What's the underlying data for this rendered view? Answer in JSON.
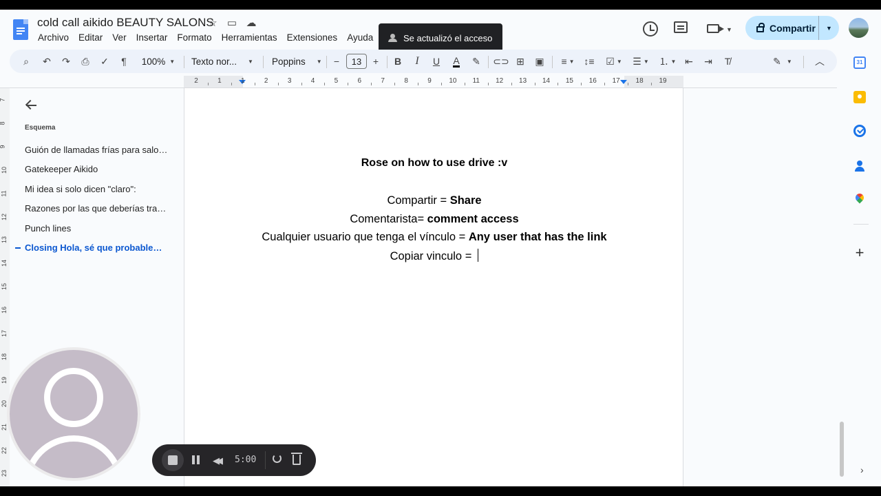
{
  "header": {
    "doc_title": "cold call aikido BEAUTY SALONS",
    "menu": [
      "Archivo",
      "Editar",
      "Ver",
      "Insertar",
      "Formato",
      "Herramientas",
      "Extensiones",
      "Ayuda"
    ],
    "toast": "Se actualizó el acceso",
    "share_label": "Compartir"
  },
  "toolbar": {
    "zoom": "100%",
    "style": "Texto nor...",
    "font": "Poppins",
    "font_size": "13"
  },
  "ruler": {
    "top_numbers": [
      "2",
      "1",
      "1",
      "2",
      "3",
      "4",
      "5",
      "6",
      "7",
      "8",
      "9",
      "10",
      "11",
      "12",
      "13",
      "14",
      "15",
      "16",
      "17",
      "18",
      "19"
    ],
    "left_numbers": [
      "7",
      "8",
      "9",
      "10",
      "11",
      "12",
      "13",
      "14",
      "15",
      "16",
      "17",
      "18",
      "19",
      "20",
      "21",
      "22",
      "23"
    ]
  },
  "outline": {
    "title": "Esquema",
    "items": [
      {
        "label": "Guión de llamadas frías para salones de belleza",
        "active": false
      },
      {
        "label": "Gatekeeper Aikido",
        "active": false
      },
      {
        "label": "Mi idea si solo dicen \"claro\":",
        "active": false
      },
      {
        "label": "Razones por las que deberías trabajar con nosotros",
        "active": false
      },
      {
        "label": "Punch lines",
        "active": false
      },
      {
        "label": "Closing Hola, sé que probablemente",
        "active": true
      }
    ]
  },
  "document": {
    "heading": "Rose on how to use drive :v",
    "lines": [
      {
        "plain": "Compartir = ",
        "bold": "Share"
      },
      {
        "plain": "Comentarista= ",
        "bold": "comment access"
      },
      {
        "plain": "Cualquier usuario que tenga el vínculo = ",
        "bold": "Any user that has the link"
      },
      {
        "plain": "Copiar vinculo = ",
        "bold": ""
      }
    ]
  },
  "side_panel": {
    "calendar_day": "31"
  },
  "recorder": {
    "time": "5:00"
  },
  "colors": {
    "accent": "#0b57d0",
    "share_bg": "#c2e7ff",
    "toolbar_bg": "#edf2fa",
    "app_bg": "#f9fbfd"
  },
  "icons": [
    "docs-logo-icon",
    "star-icon",
    "move-folder-icon",
    "cloud-icon",
    "history-icon",
    "comment-icon",
    "meet-icon",
    "lock-icon",
    "search-icon",
    "undo-icon",
    "redo-icon",
    "print-icon",
    "spellcheck-icon",
    "paint-format-icon",
    "bold-icon",
    "italic-icon",
    "underline-icon",
    "text-color-icon",
    "highlight-icon",
    "link-icon",
    "add-comment-icon",
    "image-icon",
    "align-icon",
    "line-spacing-icon",
    "checklist-icon",
    "bullet-list-icon",
    "numbered-list-icon",
    "decrease-indent-icon",
    "increase-indent-icon",
    "clear-format-icon",
    "edit-mode-icon",
    "collapse-icon",
    "back-arrow-icon",
    "calendar-icon",
    "keep-icon",
    "tasks-icon",
    "contacts-icon",
    "maps-icon",
    "plus-icon"
  ]
}
